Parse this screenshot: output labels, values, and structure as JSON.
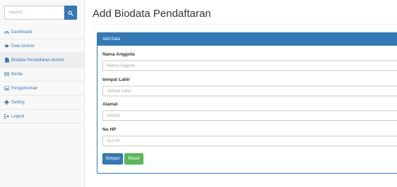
{
  "sidebar": {
    "search": {
      "placeholder": "Search..."
    },
    "items": [
      {
        "label": "Dashboard",
        "icon": "dashboard-icon"
      },
      {
        "label": "Data Alumni",
        "icon": "graduation-cap-icon"
      },
      {
        "label": "Biodata Pendaftaran Alumni",
        "icon": "file-icon",
        "active": true
      },
      {
        "label": "Berita",
        "icon": "newspaper-icon"
      },
      {
        "label": "Pengumuman",
        "icon": "picture-icon"
      },
      {
        "label": "Setting",
        "icon": "gear-icon"
      },
      {
        "label": "Logout",
        "icon": "sign-out-icon"
      }
    ]
  },
  "page": {
    "title": "Add Biodata Pendaftaran"
  },
  "panel": {
    "heading": "Add Data",
    "fields": [
      {
        "label": "Nama Anggota",
        "placeholder": "Nama Anggota"
      },
      {
        "label": "tempat Lahir",
        "placeholder": "Tempat Lahir"
      },
      {
        "label": "Alamat",
        "placeholder": "Alamat"
      },
      {
        "label": "No HP",
        "placeholder": "NO HP"
      }
    ],
    "buttons": {
      "submit": "Simpan",
      "reset": "Reset"
    }
  },
  "colors": {
    "primary": "#337ab7",
    "success": "#5cb85c",
    "sidebar_bg": "#f8f8f8",
    "active_item_bg": "#eeeeee"
  }
}
